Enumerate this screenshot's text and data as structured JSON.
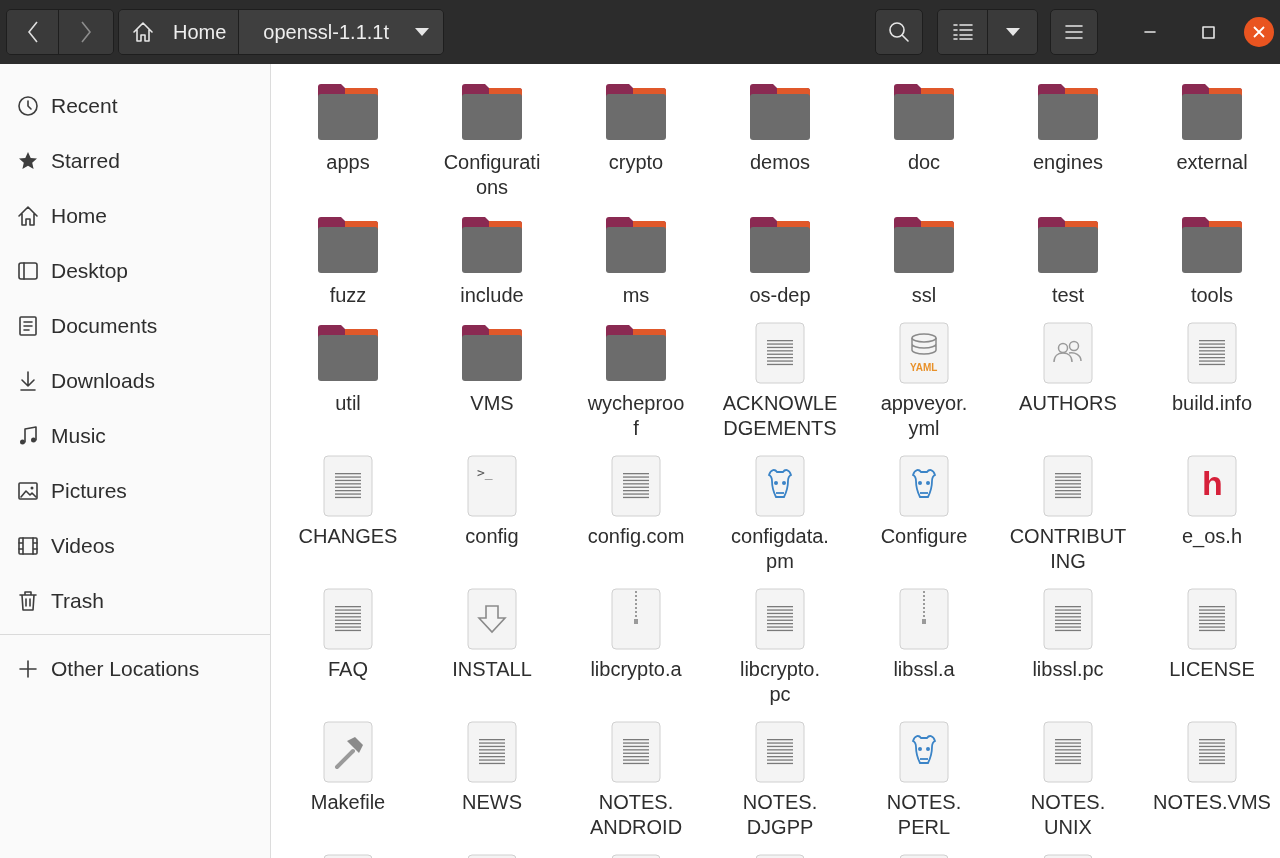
{
  "window": {
    "path": [
      {
        "label": "Home",
        "kind": "home"
      },
      {
        "label": "openssl-1.1.1t",
        "kind": "current"
      }
    ]
  },
  "sidebar": {
    "items": [
      {
        "label": "Recent",
        "kind": "recent",
        "selected": false
      },
      {
        "label": "Starred",
        "kind": "star",
        "selected": false
      },
      {
        "label": "Home",
        "kind": "home",
        "selected": false
      },
      {
        "label": "Desktop",
        "kind": "desktop",
        "selected": false
      },
      {
        "label": "Documents",
        "kind": "documents",
        "selected": false
      },
      {
        "label": "Downloads",
        "kind": "downloads",
        "selected": false
      },
      {
        "label": "Music",
        "kind": "music",
        "selected": false
      },
      {
        "label": "Pictures",
        "kind": "pictures",
        "selected": false
      },
      {
        "label": "Videos",
        "kind": "videos",
        "selected": false
      },
      {
        "label": "Trash",
        "kind": "trash",
        "selected": false
      }
    ],
    "other": {
      "label": "Other Locations",
      "kind": "plus",
      "selected": false
    }
  },
  "files": [
    {
      "lines": [
        "apps"
      ],
      "kind": "folder"
    },
    {
      "lines": [
        "Configurati",
        "ons"
      ],
      "kind": "folder"
    },
    {
      "lines": [
        "crypto"
      ],
      "kind": "folder"
    },
    {
      "lines": [
        "demos"
      ],
      "kind": "folder"
    },
    {
      "lines": [
        "doc"
      ],
      "kind": "folder"
    },
    {
      "lines": [
        "engines"
      ],
      "kind": "folder"
    },
    {
      "lines": [
        "external"
      ],
      "kind": "folder"
    },
    {
      "lines": [
        "fuzz"
      ],
      "kind": "folder"
    },
    {
      "lines": [
        "include"
      ],
      "kind": "folder"
    },
    {
      "lines": [
        "ms"
      ],
      "kind": "folder"
    },
    {
      "lines": [
        "os-dep"
      ],
      "kind": "folder"
    },
    {
      "lines": [
        "ssl"
      ],
      "kind": "folder"
    },
    {
      "lines": [
        "test"
      ],
      "kind": "folder"
    },
    {
      "lines": [
        "tools"
      ],
      "kind": "folder"
    },
    {
      "lines": [
        "util"
      ],
      "kind": "folder"
    },
    {
      "lines": [
        "VMS"
      ],
      "kind": "folder"
    },
    {
      "lines": [
        "wycheproo",
        "f"
      ],
      "kind": "folder"
    },
    {
      "lines": [
        "ACKNOWLE",
        "DGEMENTS"
      ],
      "kind": "text"
    },
    {
      "lines": [
        "appveyor.",
        "yml"
      ],
      "kind": "yaml",
      "icon_text": "YAML"
    },
    {
      "lines": [
        "AUTHORS"
      ],
      "kind": "people"
    },
    {
      "lines": [
        "build.info"
      ],
      "kind": "text"
    },
    {
      "lines": [
        "CHANGES"
      ],
      "kind": "text"
    },
    {
      "lines": [
        "config"
      ],
      "kind": "terminal",
      "icon_text": ">_"
    },
    {
      "lines": [
        "config.com"
      ],
      "kind": "text"
    },
    {
      "lines": [
        "configdata.",
        "pm"
      ],
      "kind": "perl"
    },
    {
      "lines": [
        "Configure"
      ],
      "kind": "perl"
    },
    {
      "lines": [
        "CONTRIBUT",
        "ING"
      ],
      "kind": "text"
    },
    {
      "lines": [
        "e_os.h"
      ],
      "kind": "header",
      "icon_text": "h"
    },
    {
      "lines": [
        "FAQ"
      ],
      "kind": "text"
    },
    {
      "lines": [
        "INSTALL"
      ],
      "kind": "install"
    },
    {
      "lines": [
        "libcrypto.a"
      ],
      "kind": "archive"
    },
    {
      "lines": [
        "libcrypto.",
        "pc"
      ],
      "kind": "text"
    },
    {
      "lines": [
        "libssl.a"
      ],
      "kind": "archive"
    },
    {
      "lines": [
        "libssl.pc"
      ],
      "kind": "text"
    },
    {
      "lines": [
        "LICENSE"
      ],
      "kind": "text"
    },
    {
      "lines": [
        "Makefile"
      ],
      "kind": "makefile"
    },
    {
      "lines": [
        "NEWS"
      ],
      "kind": "text"
    },
    {
      "lines": [
        "NOTES.",
        "ANDROID"
      ],
      "kind": "text"
    },
    {
      "lines": [
        "NOTES.",
        "DJGPP"
      ],
      "kind": "text"
    },
    {
      "lines": [
        "NOTES.",
        "PERL"
      ],
      "kind": "perl"
    },
    {
      "lines": [
        "NOTES.",
        "UNIX"
      ],
      "kind": "text"
    },
    {
      "lines": [
        "NOTES.VMS"
      ],
      "kind": "text"
    }
  ],
  "cut_off_files": [
    {
      "kind": "text"
    },
    {
      "kind": "text"
    },
    {
      "kind": "text"
    },
    {
      "kind": "text"
    },
    {
      "kind": "text"
    },
    {
      "kind": "text"
    }
  ]
}
